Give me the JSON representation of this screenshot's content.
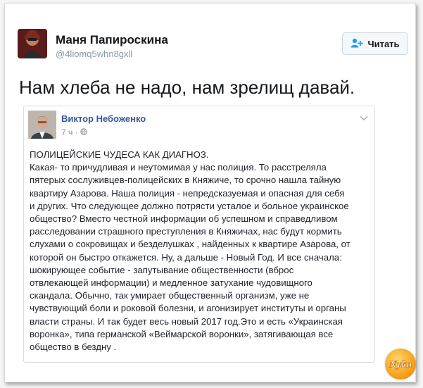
{
  "tweet": {
    "author_name": "Маня Папироскина",
    "author_handle": "@4liomq5whn8gxll",
    "follow_label": "Читать",
    "text": "Нам хлеба не надо, нам зрелищ давай."
  },
  "embedded_post": {
    "author_name": "Виктор Небоженко",
    "time": "7 ч ·",
    "body_lines": [
      "ПОЛИЦЕЙСКИЕ ЧУДЕСА КАК ДИАГНОЗ.",
      "Какая- то причудливая и неутомимая у нас полиция. То расстреляла",
      "пятерых сослуживцев-полицейских в Княжиче, то срочно нашла тайную",
      "квартиру Азарова. Наша полиция - непредсказуемая и опасная для себя",
      "и других. Что следующее должно потрясти усталое и больное украинское",
      "общество? Вместо честной информации об успешном и справедливом",
      "расследовании страшного преступления в Княжичах, нас будут кормить",
      "слухами о сокровищах и безделушках , найденных к квартире Азарова, от",
      "которой он быстро откажется. Ну, а дальше - Новый Год. И все сначала:",
      "шокирующее событие - запутывание общественности (вброс",
      "отвлекающей информации) и медленное затухание чудовищного",
      "скандала. Обычно, так умирает общественный организм, уже не",
      "чувствующий боли и роковой болезни, и агонизирует институты и органы",
      "власти страны. И так будет весь новый 2017 год.Это и есть «Украинская",
      "воронка», типа германской «Веймарской воронки», затягивающая все",
      "общество в бездну ."
    ]
  },
  "watermark": {
    "text": "Nyka"
  },
  "colors": {
    "fb_link": "#365899",
    "twitter_handle": "#8899a6",
    "follow_icon": "#1da1f2"
  },
  "icons": {
    "follow": "add-user-icon",
    "privacy": "globe-icon",
    "menu": "chevron-down-icon"
  }
}
